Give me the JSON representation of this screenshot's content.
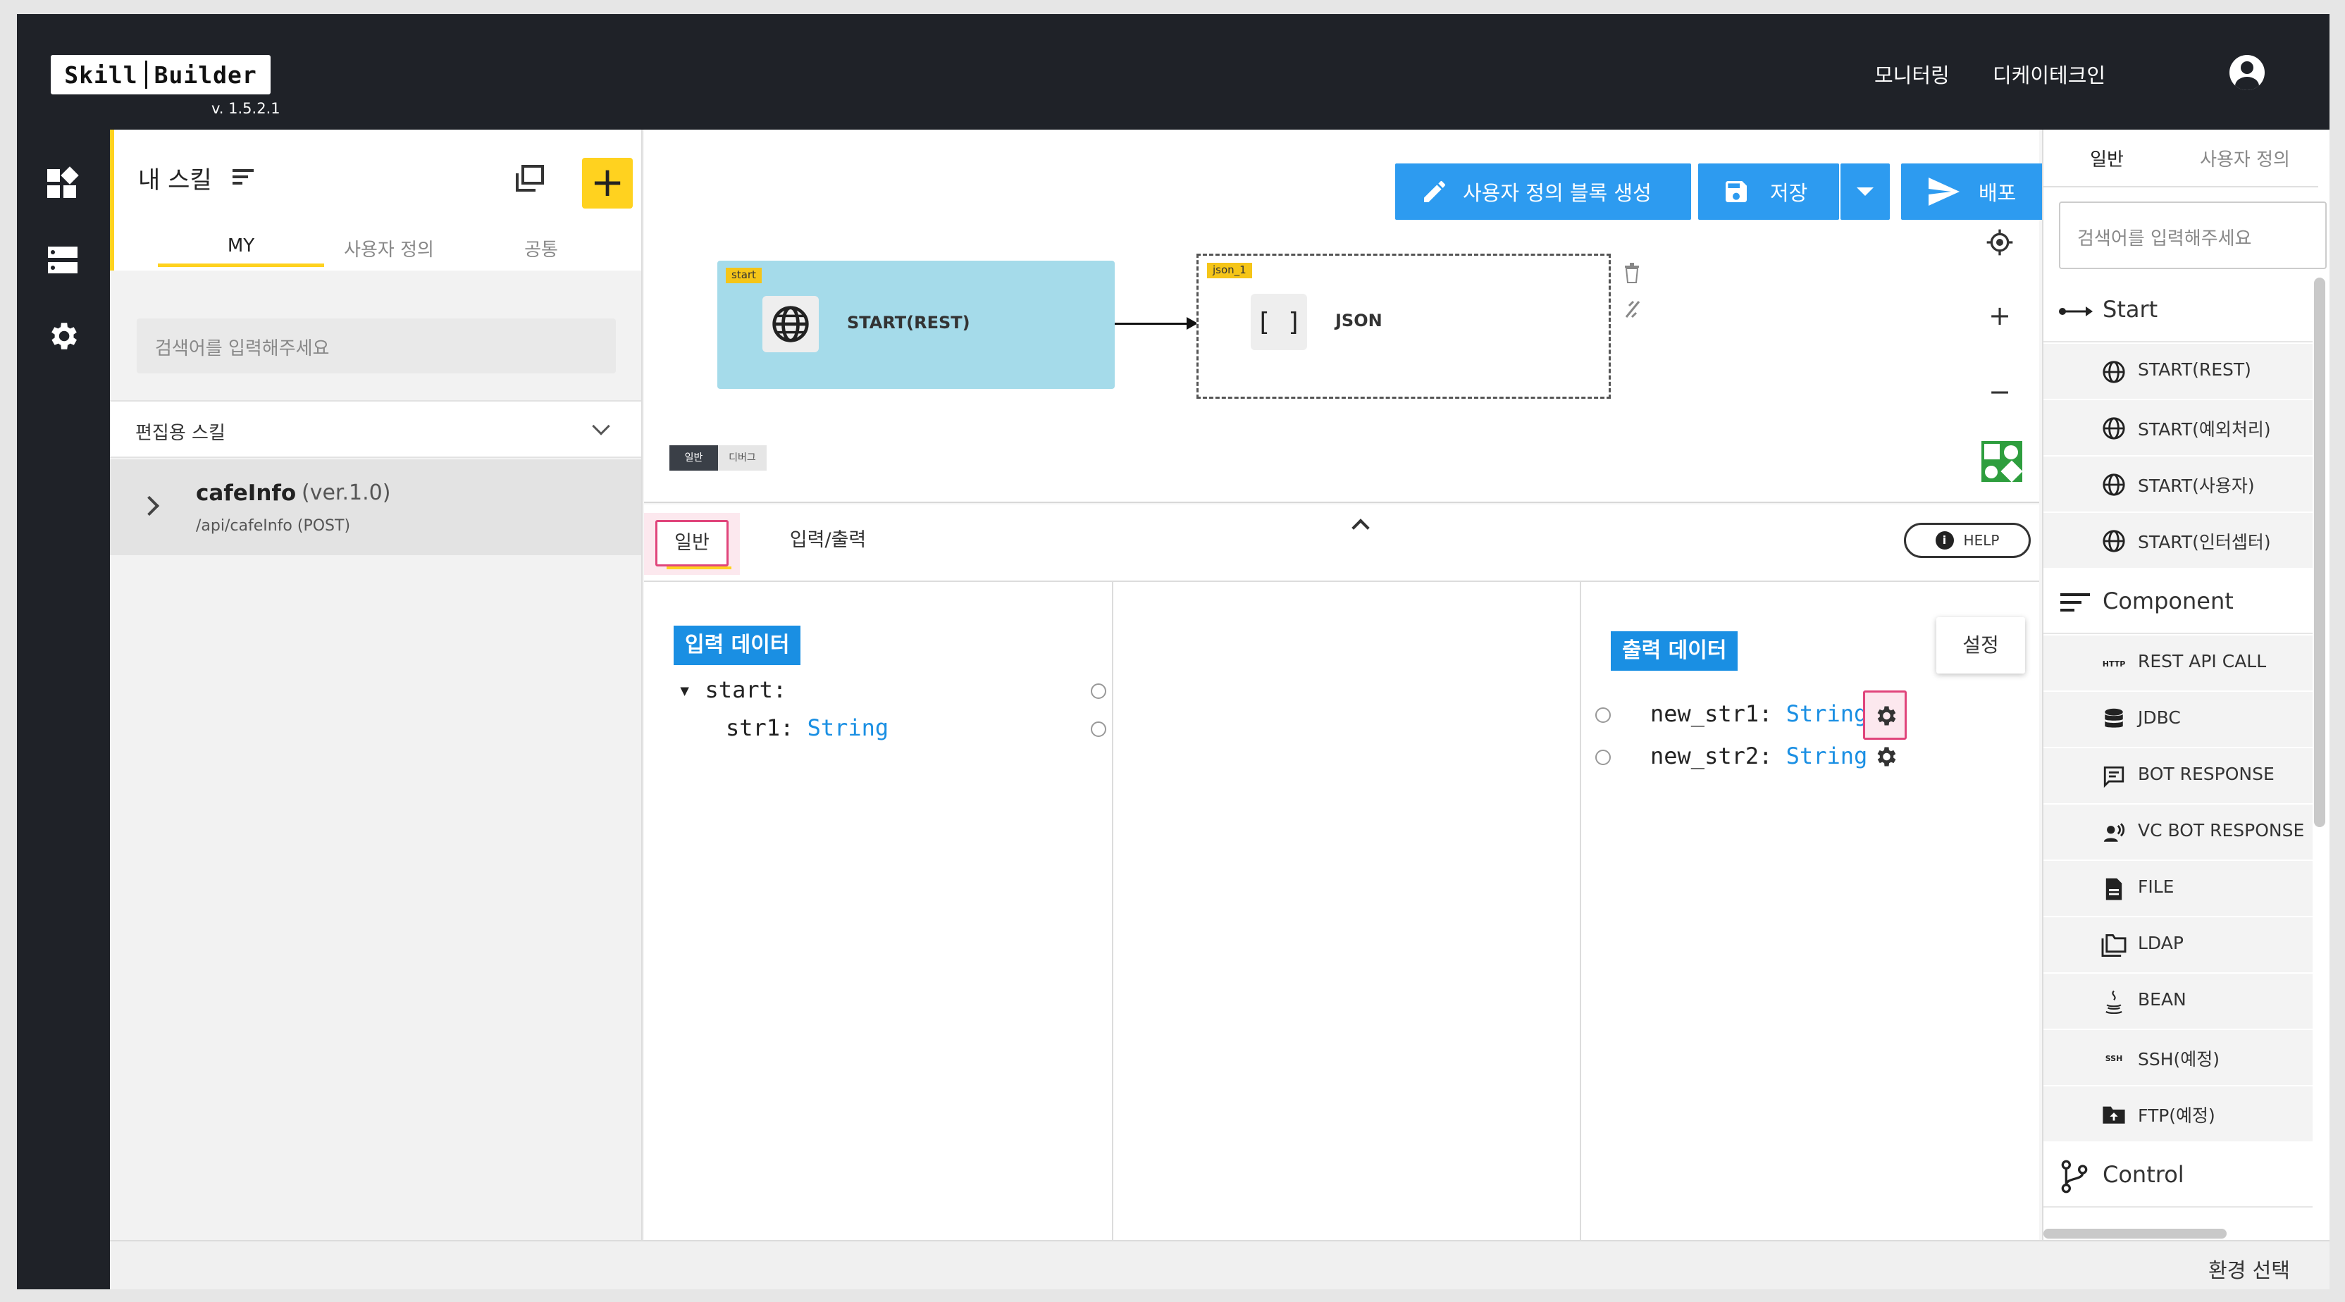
{
  "app": {
    "logo_left": "Skill",
    "logo_right": "Builder",
    "version": "v. 1.5.2.1"
  },
  "topbar": {
    "monitoring": "모니터링",
    "company": "디케이테크인"
  },
  "sidebar": {
    "title": "내 스킬",
    "tabs": [
      "MY",
      "사용자 정의",
      "공통"
    ],
    "search_placeholder": "검색어를 입력해주세요",
    "section_label": "편집용 스킬",
    "skill": {
      "name": "cafeInfo",
      "version": "(ver.1.0)",
      "path": "/api/cafeInfo (POST)"
    }
  },
  "toolbar": {
    "custom_block": "사용자 정의 블록 생성",
    "save": "저장",
    "deploy": "배포"
  },
  "canvas": {
    "start_node": {
      "tag": "start",
      "label": "START(REST)"
    },
    "json_node": {
      "tag": "json_1",
      "label": "JSON",
      "icon_text": "[ ]"
    },
    "mini_tabs": [
      "일반",
      "디버그"
    ],
    "zoom_in": "+",
    "zoom_out": "−"
  },
  "detail": {
    "tabs": [
      "일반",
      "입력/출력"
    ],
    "help": "HELP",
    "input_badge": "입력 데이터",
    "input_root": "▾ start:",
    "input_field": {
      "name": "str1:",
      "type": "String"
    },
    "output_badge": "출력 데이터",
    "output_fields": [
      {
        "name": "new_str1:",
        "type": "String"
      },
      {
        "name": "new_str2:",
        "type": "String"
      }
    ],
    "setting_popup": "설정"
  },
  "palette": {
    "tabs": [
      "일반",
      "사용자 정의"
    ],
    "search_placeholder": "검색어를 입력해주세요",
    "groups": {
      "start": "Start",
      "component": "Component",
      "control": "Control"
    },
    "start_items": [
      "START(REST)",
      "START(예외처리)",
      "START(사용자)",
      "START(인터셉터)"
    ],
    "component_items": [
      "REST API CALL",
      "JDBC",
      "BOT RESPONSE",
      "VC BOT RESPONSE",
      "FILE",
      "LDAP",
      "BEAN",
      "SSH(예정)",
      "FTP(예정)"
    ],
    "icon_labels": {
      "http": "HTTP",
      "ssh": "SSH"
    }
  },
  "footer": {
    "env_select": "환경 선택"
  },
  "colors": {
    "accent_yellow": "#ffd21f",
    "primary_blue": "#2d9bf0",
    "start_node": "#a5dbea",
    "highlight_pink": "#e0457b",
    "dark_bg": "#1f2228"
  }
}
